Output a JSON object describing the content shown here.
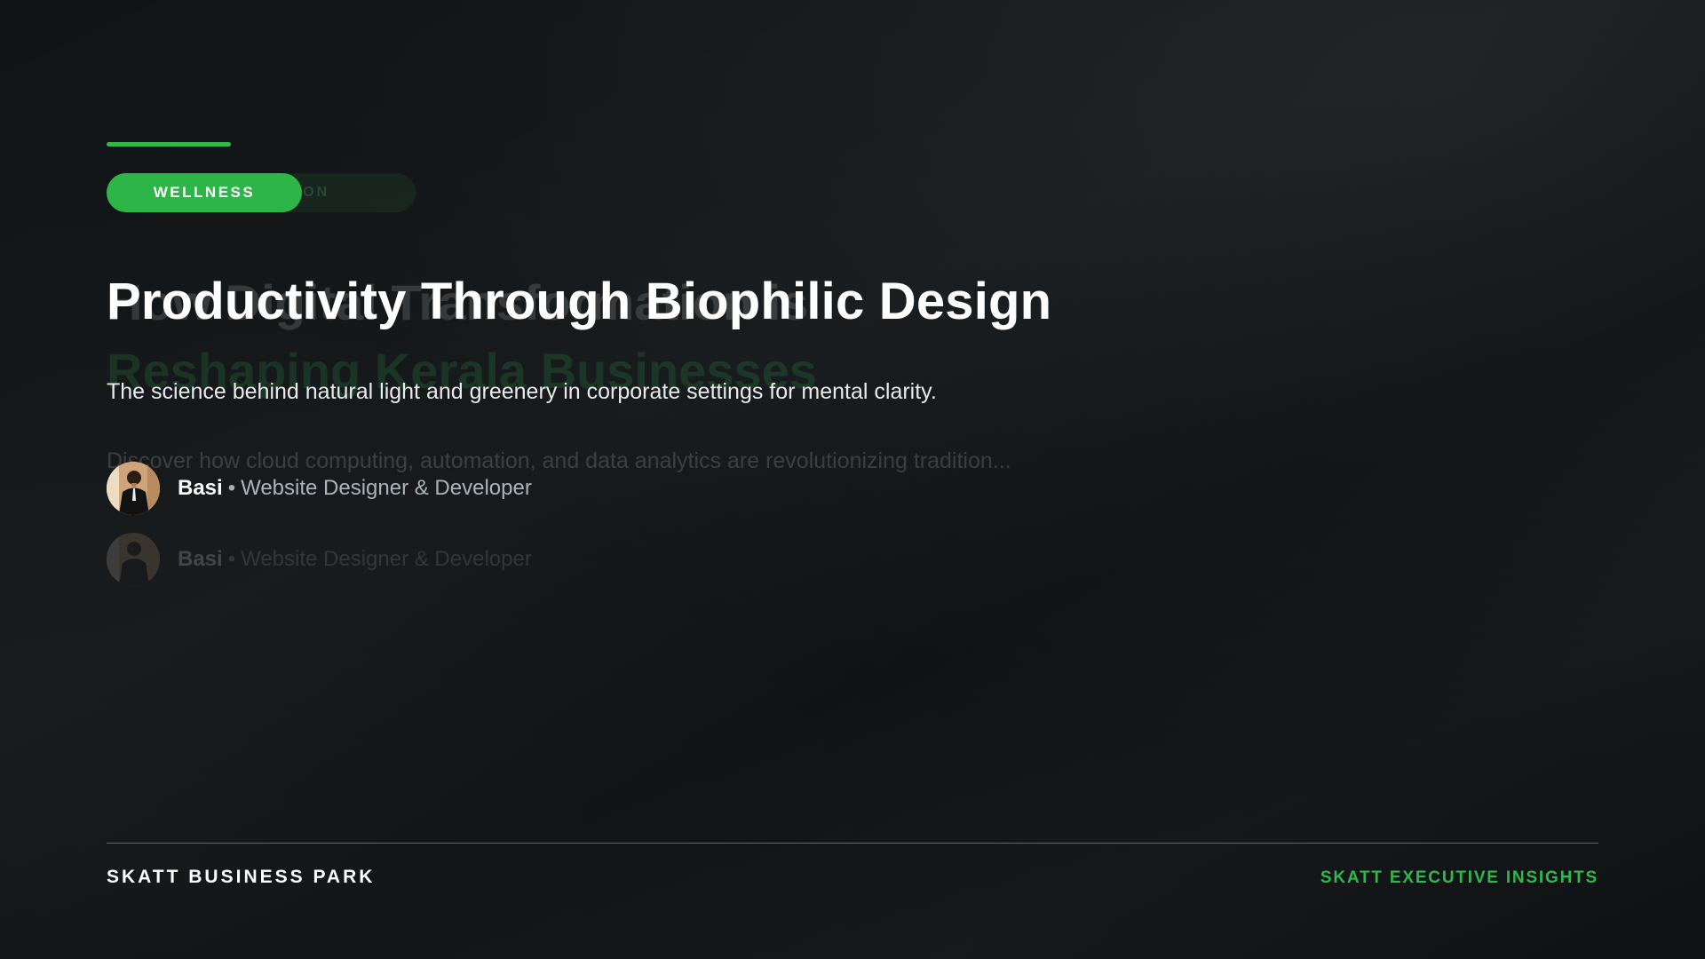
{
  "colors": {
    "accent": "#2fb84b",
    "background": "#111416",
    "text_primary": "#ffffff",
    "text_secondary": "#aab4bb"
  },
  "tags": {
    "active_label": "WELLNESS",
    "next_label_partial": "RMATION"
  },
  "ghost": {
    "title": "How Digital Transformation is",
    "subtitle": "Reshaping Kerala Businesses",
    "description": "Discover how cloud computing, automation, and data analytics are revolutionizing tradition...",
    "author_name": "Basi",
    "author_role": "Website Designer & Developer"
  },
  "article": {
    "title": "Productivity Through Biophilic Design",
    "description": "The science behind natural light and greenery in corporate settings for mental clarity.",
    "author_name": "Basi",
    "author_separator": "•",
    "author_role": "Website Designer & Developer",
    "avatar_icon": "author-avatar"
  },
  "footer": {
    "brand": "SKATT BUSINESS PARK",
    "series": "SKATT EXECUTIVE INSIGHTS"
  }
}
